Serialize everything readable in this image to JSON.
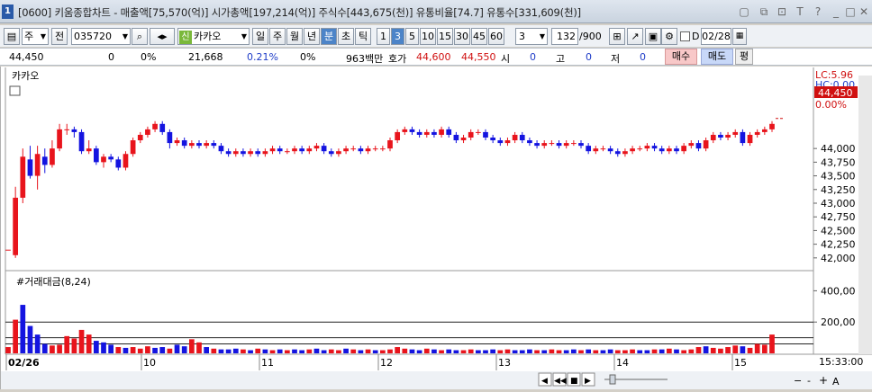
{
  "window": {
    "index": "1",
    "title": "[0600] 키움종합차트 - 매출액[75,570(억)] 시가총액[197,214(억)] 주식수[443,675(천)] 유통비율[74.7] 유통수[331,609(천)]"
  },
  "toolbar": {
    "market": "주",
    "scope": "전",
    "code": "035720",
    "name_badge": "신",
    "stock_name": "카카오",
    "period_tabs": [
      "일",
      "주",
      "월",
      "년",
      "분",
      "초",
      "틱"
    ],
    "selected_period": "분",
    "interval_buttons": [
      "1",
      "3",
      "5",
      "10",
      "15",
      "30",
      "45",
      "60"
    ],
    "selected_interval": "3",
    "interval_value": "3",
    "count_value": "132",
    "count_max": "/900",
    "d_label": "D",
    "date_value": "02/28"
  },
  "infobar": {
    "price": "44,450",
    "change": "0",
    "change_pct": "0%",
    "volume": "21,668",
    "volume_pct": "0.21%",
    "zero_pct": "0%",
    "amount": "963백만",
    "quote_label": "호가",
    "ask": "44,600",
    "bid": "44,550",
    "open_label": "시",
    "open": "0",
    "high_label": "고",
    "high": "0",
    "low_label": "저",
    "low": "0",
    "buy_label": "매수",
    "sell_label": "매도",
    "eval_label": "평"
  },
  "chart_data": [
    {
      "type": "candlestick",
      "title": "카카오",
      "ylim": [
        41800,
        45400
      ],
      "yticks": [
        "44,000",
        "43,750",
        "43,500",
        "43,250",
        "43,000",
        "42,750",
        "42,500",
        "42,250",
        "42,000"
      ],
      "ytick_values": [
        44000,
        43750,
        43500,
        43250,
        43000,
        42750,
        42500,
        42250,
        42000
      ],
      "annotations": {
        "lc": "LC:5.96",
        "hc": "HC:0.00",
        "current_price": "44,450",
        "current_pct": "0.00%"
      },
      "x_date_labels": [
        "02/26",
        "10",
        "11",
        "12",
        "13",
        "14",
        "15"
      ],
      "candles": [
        {
          "o": 42150,
          "c": 42150,
          "h": 42150,
          "l": 42150
        },
        {
          "o": 42050,
          "c": 43100,
          "h": 43300,
          "l": 42000
        },
        {
          "o": 43100,
          "c": 43850,
          "h": 44000,
          "l": 43000
        },
        {
          "o": 43800,
          "c": 43500,
          "h": 44050,
          "l": 43450
        },
        {
          "o": 43500,
          "c": 43900,
          "h": 44050,
          "l": 43250
        },
        {
          "o": 43850,
          "c": 43700,
          "h": 44000,
          "l": 43550
        },
        {
          "o": 43700,
          "c": 44000,
          "h": 44150,
          "l": 43650
        },
        {
          "o": 44000,
          "c": 44350,
          "h": 44450,
          "l": 43950
        },
        {
          "o": 44350,
          "c": 44350,
          "h": 44450,
          "l": 44250
        },
        {
          "o": 44350,
          "c": 44300,
          "h": 44400,
          "l": 44200
        },
        {
          "o": 44300,
          "c": 43950,
          "h": 44350,
          "l": 43900
        },
        {
          "o": 43950,
          "c": 44000,
          "h": 44150,
          "l": 43900
        },
        {
          "o": 44000,
          "c": 43750,
          "h": 44050,
          "l": 43700
        },
        {
          "o": 43750,
          "c": 43850,
          "h": 43900,
          "l": 43650
        },
        {
          "o": 43850,
          "c": 43800,
          "h": 43900,
          "l": 43750
        },
        {
          "o": 43800,
          "c": 43650,
          "h": 43850,
          "l": 43600
        },
        {
          "o": 43650,
          "c": 43900,
          "h": 43950,
          "l": 43600
        },
        {
          "o": 43900,
          "c": 44150,
          "h": 44200,
          "l": 43850
        },
        {
          "o": 44150,
          "c": 44250,
          "h": 44300,
          "l": 44100
        },
        {
          "o": 44250,
          "c": 44350,
          "h": 44400,
          "l": 44200
        },
        {
          "o": 44350,
          "c": 44450,
          "h": 44500,
          "l": 44300
        },
        {
          "o": 44450,
          "c": 44300,
          "h": 44500,
          "l": 44250
        },
        {
          "o": 44300,
          "c": 44100,
          "h": 44350,
          "l": 44000
        },
        {
          "o": 44100,
          "c": 44150,
          "h": 44200,
          "l": 44050
        },
        {
          "o": 44150,
          "c": 44050,
          "h": 44200,
          "l": 44000
        },
        {
          "o": 44050,
          "c": 44100,
          "h": 44150,
          "l": 44000
        },
        {
          "o": 44100,
          "c": 44050,
          "h": 44150,
          "l": 44000
        },
        {
          "o": 44050,
          "c": 44100,
          "h": 44150,
          "l": 44000
        },
        {
          "o": 44100,
          "c": 44050,
          "h": 44150,
          "l": 44000
        },
        {
          "o": 44050,
          "c": 43950,
          "h": 44100,
          "l": 43900
        },
        {
          "o": 43950,
          "c": 43900,
          "h": 44000,
          "l": 43850
        },
        {
          "o": 43900,
          "c": 43950,
          "h": 44000,
          "l": 43850
        },
        {
          "o": 43950,
          "c": 43900,
          "h": 44000,
          "l": 43850
        },
        {
          "o": 43900,
          "c": 43950,
          "h": 44000,
          "l": 43850
        },
        {
          "o": 43950,
          "c": 43900,
          "h": 44000,
          "l": 43850
        },
        {
          "o": 43900,
          "c": 43950,
          "h": 44000,
          "l": 43850
        },
        {
          "o": 43950,
          "c": 44000,
          "h": 44050,
          "l": 43900
        },
        {
          "o": 44000,
          "c": 43950,
          "h": 44050,
          "l": 43900
        },
        {
          "o": 43950,
          "c": 43950,
          "h": 44000,
          "l": 43900
        },
        {
          "o": 43950,
          "c": 44000,
          "h": 44050,
          "l": 43900
        },
        {
          "o": 44000,
          "c": 43950,
          "h": 44050,
          "l": 43900
        },
        {
          "o": 43950,
          "c": 44000,
          "h": 44050,
          "l": 43900
        },
        {
          "o": 44000,
          "c": 44050,
          "h": 44100,
          "l": 43950
        },
        {
          "o": 44050,
          "c": 43950,
          "h": 44100,
          "l": 43900
        },
        {
          "o": 43950,
          "c": 43900,
          "h": 44000,
          "l": 43850
        },
        {
          "o": 43900,
          "c": 43950,
          "h": 44000,
          "l": 43850
        },
        {
          "o": 43950,
          "c": 44000,
          "h": 44050,
          "l": 43900
        },
        {
          "o": 44000,
          "c": 44000,
          "h": 44050,
          "l": 43950
        },
        {
          "o": 44000,
          "c": 43950,
          "h": 44050,
          "l": 43900
        },
        {
          "o": 43950,
          "c": 44000,
          "h": 44050,
          "l": 43900
        },
        {
          "o": 44000,
          "c": 44000,
          "h": 44050,
          "l": 43950
        },
        {
          "o": 44000,
          "c": 44000,
          "h": 44050,
          "l": 43950
        },
        {
          "o": 44000,
          "c": 44150,
          "h": 44200,
          "l": 43950
        },
        {
          "o": 44150,
          "c": 44300,
          "h": 44350,
          "l": 44100
        },
        {
          "o": 44300,
          "c": 44350,
          "h": 44400,
          "l": 44250
        },
        {
          "o": 44350,
          "c": 44300,
          "h": 44400,
          "l": 44250
        },
        {
          "o": 44300,
          "c": 44250,
          "h": 44350,
          "l": 44200
        },
        {
          "o": 44250,
          "c": 44300,
          "h": 44350,
          "l": 44200
        },
        {
          "o": 44300,
          "c": 44250,
          "h": 44350,
          "l": 44200
        },
        {
          "o": 44250,
          "c": 44350,
          "h": 44400,
          "l": 44200
        },
        {
          "o": 44350,
          "c": 44250,
          "h": 44400,
          "l": 44200
        },
        {
          "o": 44250,
          "c": 44150,
          "h": 44300,
          "l": 44100
        },
        {
          "o": 44150,
          "c": 44200,
          "h": 44250,
          "l": 44100
        },
        {
          "o": 44200,
          "c": 44300,
          "h": 44350,
          "l": 44150
        },
        {
          "o": 44300,
          "c": 44300,
          "h": 44350,
          "l": 44250
        },
        {
          "o": 44300,
          "c": 44200,
          "h": 44350,
          "l": 44150
        },
        {
          "o": 44200,
          "c": 44150,
          "h": 44250,
          "l": 44100
        },
        {
          "o": 44150,
          "c": 44100,
          "h": 44200,
          "l": 44050
        },
        {
          "o": 44100,
          "c": 44150,
          "h": 44200,
          "l": 44050
        },
        {
          "o": 44150,
          "c": 44250,
          "h": 44300,
          "l": 44100
        },
        {
          "o": 44250,
          "c": 44150,
          "h": 44300,
          "l": 44100
        },
        {
          "o": 44150,
          "c": 44100,
          "h": 44200,
          "l": 44050
        },
        {
          "o": 44100,
          "c": 44050,
          "h": 44150,
          "l": 44000
        },
        {
          "o": 44050,
          "c": 44100,
          "h": 44150,
          "l": 44000
        },
        {
          "o": 44100,
          "c": 44100,
          "h": 44150,
          "l": 44050
        },
        {
          "o": 44100,
          "c": 44050,
          "h": 44150,
          "l": 44000
        },
        {
          "o": 44050,
          "c": 44100,
          "h": 44150,
          "l": 44000
        },
        {
          "o": 44100,
          "c": 44100,
          "h": 44150,
          "l": 44050
        },
        {
          "o": 44100,
          "c": 44050,
          "h": 44150,
          "l": 44000
        },
        {
          "o": 44050,
          "c": 43950,
          "h": 44100,
          "l": 43900
        },
        {
          "o": 43950,
          "c": 44000,
          "h": 44050,
          "l": 43900
        },
        {
          "o": 44000,
          "c": 44000,
          "h": 44050,
          "l": 43950
        },
        {
          "o": 44000,
          "c": 43950,
          "h": 44050,
          "l": 43900
        },
        {
          "o": 43950,
          "c": 43900,
          "h": 44000,
          "l": 43850
        },
        {
          "o": 43900,
          "c": 43950,
          "h": 44000,
          "l": 43850
        },
        {
          "o": 43950,
          "c": 44000,
          "h": 44050,
          "l": 43900
        },
        {
          "o": 44000,
          "c": 44000,
          "h": 44050,
          "l": 43950
        },
        {
          "o": 44000,
          "c": 44050,
          "h": 44100,
          "l": 43950
        },
        {
          "o": 44050,
          "c": 44000,
          "h": 44100,
          "l": 43950
        },
        {
          "o": 44000,
          "c": 43950,
          "h": 44050,
          "l": 43900
        },
        {
          "o": 43950,
          "c": 44000,
          "h": 44050,
          "l": 43900
        },
        {
          "o": 44000,
          "c": 43950,
          "h": 44050,
          "l": 43900
        },
        {
          "o": 43950,
          "c": 44050,
          "h": 44100,
          "l": 43900
        },
        {
          "o": 44050,
          "c": 44100,
          "h": 44150,
          "l": 44000
        },
        {
          "o": 44100,
          "c": 44000,
          "h": 44150,
          "l": 43950
        },
        {
          "o": 44000,
          "c": 44150,
          "h": 44200,
          "l": 43950
        },
        {
          "o": 44150,
          "c": 44250,
          "h": 44300,
          "l": 44100
        },
        {
          "o": 44250,
          "c": 44200,
          "h": 44300,
          "l": 44150
        },
        {
          "o": 44200,
          "c": 44250,
          "h": 44300,
          "l": 44150
        },
        {
          "o": 44250,
          "c": 44300,
          "h": 44350,
          "l": 44200
        },
        {
          "o": 44300,
          "c": 44100,
          "h": 44350,
          "l": 44050
        },
        {
          "o": 44100,
          "c": 44250,
          "h": 44300,
          "l": 44050
        },
        {
          "o": 44250,
          "c": 44300,
          "h": 44350,
          "l": 44200
        },
        {
          "o": 44300,
          "c": 44350,
          "h": 44400,
          "l": 44250
        },
        {
          "o": 44350,
          "c": 44450,
          "h": 44500,
          "l": 44300
        }
      ],
      "colors": {
        "up": "#e8141c",
        "down": "#1414e0"
      }
    },
    {
      "type": "bar",
      "title": "#거래대금(8,24)",
      "ylim": [
        0,
        500
      ],
      "yticks": [
        "400,00",
        "200,00"
      ],
      "ytick_values": [
        400,
        200
      ],
      "reference_lines": [
        200,
        100,
        60
      ],
      "values": [
        40,
        215,
        310,
        175,
        120,
        60,
        50,
        55,
        110,
        95,
        150,
        120,
        80,
        70,
        55,
        40,
        35,
        40,
        30,
        45,
        35,
        40,
        30,
        55,
        45,
        90,
        70,
        40,
        30,
        25,
        25,
        30,
        25,
        20,
        30,
        25,
        20,
        25,
        20,
        25,
        20,
        25,
        30,
        20,
        25,
        20,
        30,
        25,
        20,
        25,
        20,
        20,
        25,
        40,
        30,
        25,
        20,
        30,
        25,
        20,
        25,
        20,
        20,
        25,
        20,
        20,
        25,
        20,
        25,
        20,
        20,
        25,
        20,
        20,
        25,
        20,
        20,
        25,
        20,
        25,
        20,
        20,
        25,
        20,
        20,
        25,
        20,
        20,
        25,
        25,
        30,
        25,
        20,
        25,
        40,
        45,
        35,
        30,
        40,
        50,
        45,
        35,
        60,
        55,
        120
      ],
      "up": [
        true,
        true,
        false,
        false,
        false,
        false,
        true,
        true,
        true,
        true,
        true,
        true,
        false,
        false,
        false,
        true,
        false,
        true,
        true,
        true,
        false,
        false,
        true,
        false,
        false,
        true,
        true,
        false,
        true,
        false,
        false,
        false,
        true,
        false,
        true,
        false,
        true,
        false,
        true,
        false,
        false,
        true,
        false,
        false,
        true,
        true,
        false,
        true,
        false,
        true,
        false,
        true,
        true,
        true,
        true,
        false,
        false,
        true,
        false,
        true,
        false,
        false,
        true,
        true,
        false,
        false,
        false,
        true,
        true,
        false,
        false,
        false,
        true,
        false,
        true,
        true,
        false,
        false,
        true,
        false,
        true,
        false,
        false,
        true,
        true,
        true,
        false,
        false,
        true,
        false,
        true,
        false,
        true,
        true,
        true,
        false,
        true,
        true,
        true,
        true,
        false,
        true,
        true,
        true,
        true
      ]
    }
  ],
  "status": {
    "time": "15:33:00"
  }
}
